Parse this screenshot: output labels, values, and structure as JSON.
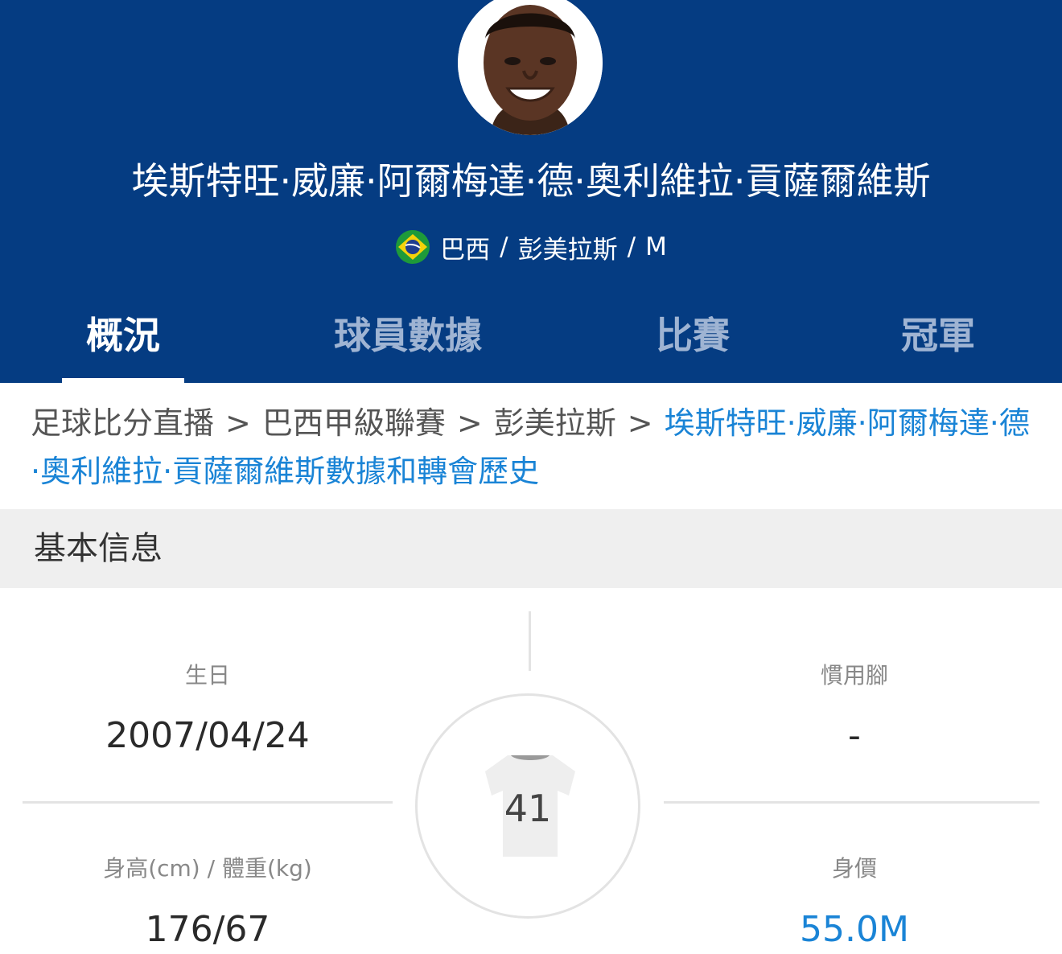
{
  "player": {
    "name": "埃斯特旺·威廉·阿爾梅達·德·奧利維拉·貢薩爾維斯",
    "country": "巴西",
    "club": "彭美拉斯",
    "position": "M",
    "separator": "/"
  },
  "tabs": [
    {
      "label": "概況",
      "active": true
    },
    {
      "label": "球員數據",
      "active": false
    },
    {
      "label": "比賽",
      "active": false
    },
    {
      "label": "冠軍",
      "active": false
    }
  ],
  "breadcrumb": {
    "items": [
      "足球比分直播",
      "巴西甲級聯賽",
      "彭美拉斯"
    ],
    "current": "埃斯特旺·威廉·阿爾梅達·德·奧利維拉·貢薩爾維斯數據和轉會歷史",
    "chevron": ">"
  },
  "basic_info": {
    "title": "基本信息",
    "birthday_label": "生日",
    "birthday": "2007/04/24",
    "foot_label": "慣用腳",
    "foot": "-",
    "height_weight_label": "身高(cm) / 體重(kg)",
    "height_weight": "176/67",
    "value_label": "身價",
    "value": "55.0M",
    "shirt_number": "41"
  },
  "colors": {
    "header_bg": "#053c82",
    "accent_blue": "#1a84d6",
    "section_bg": "#efefef"
  },
  "icons": {
    "flag": "brazil-flag-icon",
    "jersey": "jersey-icon",
    "chevron": "chevron-right-icon"
  }
}
